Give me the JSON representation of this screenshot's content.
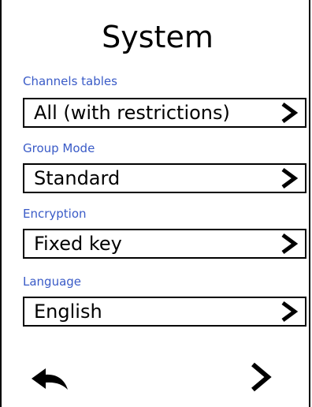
{
  "screen": {
    "title": "System"
  },
  "settings": [
    {
      "label": "Channels tables",
      "value": "All (with restrictions)",
      "icon": "chevron-right-icon"
    },
    {
      "label": "Group Mode",
      "value": "Standard",
      "icon": "chevron-right-icon"
    },
    {
      "label": "Encryption",
      "value": "Fixed key",
      "icon": "chevron-right-icon"
    },
    {
      "label": "Language",
      "value": "English",
      "icon": "chevron-right-icon"
    }
  ],
  "navigation": {
    "back_icon": "back-arrow-icon",
    "next_icon": "chevron-right-icon"
  },
  "colors": {
    "label": "#3a5bc7",
    "text": "#000000",
    "background": "#ffffff"
  }
}
